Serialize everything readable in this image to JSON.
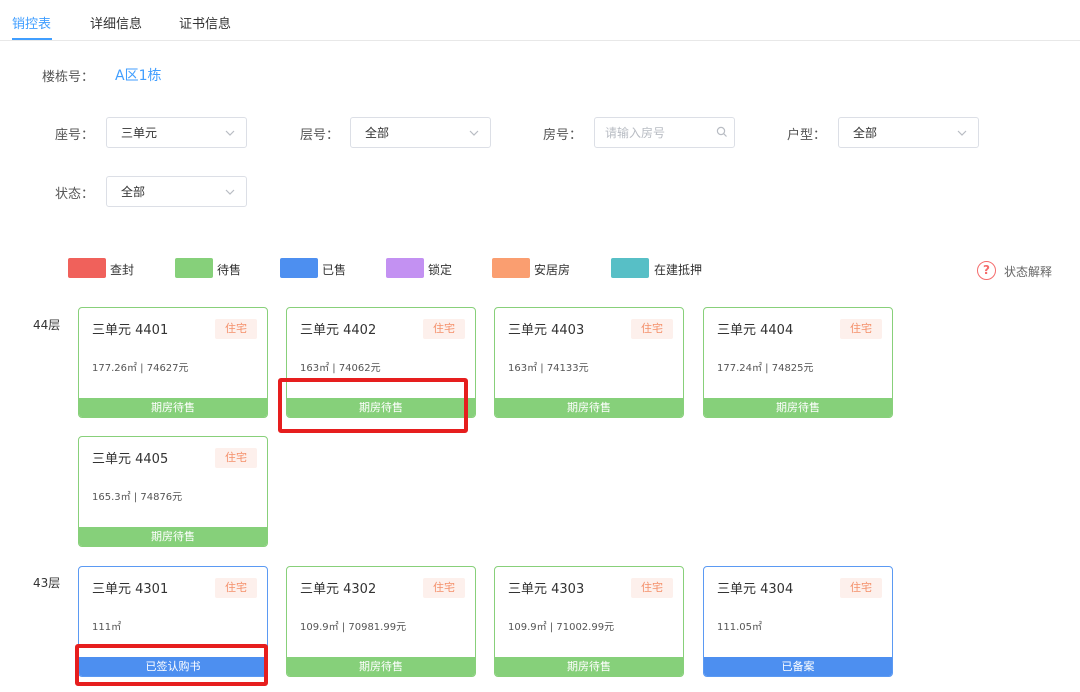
{
  "tabs": [
    {
      "label": "销控表",
      "active": true
    },
    {
      "label": "详细信息",
      "active": false
    },
    {
      "label": "证书信息",
      "active": false
    }
  ],
  "building": {
    "label": "楼栋号：",
    "value": "A区1栋"
  },
  "filters": {
    "unit": {
      "label": "座号：",
      "value": "三单元"
    },
    "floor": {
      "label": "层号：",
      "value": "全部"
    },
    "room": {
      "label": "房号：",
      "placeholder": "请输入房号"
    },
    "layout": {
      "label": "户型：",
      "value": "全部"
    },
    "status": {
      "label": "状态：",
      "value": "全部"
    }
  },
  "legend": [
    {
      "label": "查封",
      "color": "#f0615b"
    },
    {
      "label": "待售",
      "color": "#86d07a"
    },
    {
      "label": "已售",
      "color": "#4d8ff0"
    },
    {
      "label": "锁定",
      "color": "#c391f2"
    },
    {
      "label": "安居房",
      "color": "#fa9e70"
    },
    {
      "label": "在建抵押",
      "color": "#57bfc6"
    }
  ],
  "help": {
    "icon": "question-circle-icon",
    "label": "状态解释"
  },
  "floors": [
    {
      "label": "44层",
      "units": [
        {
          "title": "三单元 4401",
          "tag": "住宅",
          "info": "177.26㎡ | 74627元",
          "status": "期房待售",
          "status_color": "green"
        },
        {
          "title": "三单元 4402",
          "tag": "住宅",
          "info": "163㎡ | 74062元",
          "status": "期房待售",
          "status_color": "green"
        },
        {
          "title": "三单元 4403",
          "tag": "住宅",
          "info": "163㎡ | 74133元",
          "status": "期房待售",
          "status_color": "green"
        },
        {
          "title": "三单元 4404",
          "tag": "住宅",
          "info": "177.24㎡ | 74825元",
          "status": "期房待售",
          "status_color": "green"
        },
        {
          "title": "三单元 4405",
          "tag": "住宅",
          "info": "165.3㎡ | 74876元",
          "status": "期房待售",
          "status_color": "green"
        }
      ]
    },
    {
      "label": "43层",
      "units": [
        {
          "title": "三单元 4301",
          "tag": "住宅",
          "info": "111㎡",
          "status": "已签认购书",
          "status_color": "blue"
        },
        {
          "title": "三单元 4302",
          "tag": "住宅",
          "info": "109.9㎡ | 70981.99元",
          "status": "期房待售",
          "status_color": "green"
        },
        {
          "title": "三单元 4303",
          "tag": "住宅",
          "info": "109.9㎡ | 71002.99元",
          "status": "期房待售",
          "status_color": "green"
        },
        {
          "title": "三单元 4304",
          "tag": "住宅",
          "info": "111.05㎡",
          "status": "已备案",
          "status_color": "blue"
        }
      ]
    }
  ],
  "annotation_color": "#e61e1e"
}
